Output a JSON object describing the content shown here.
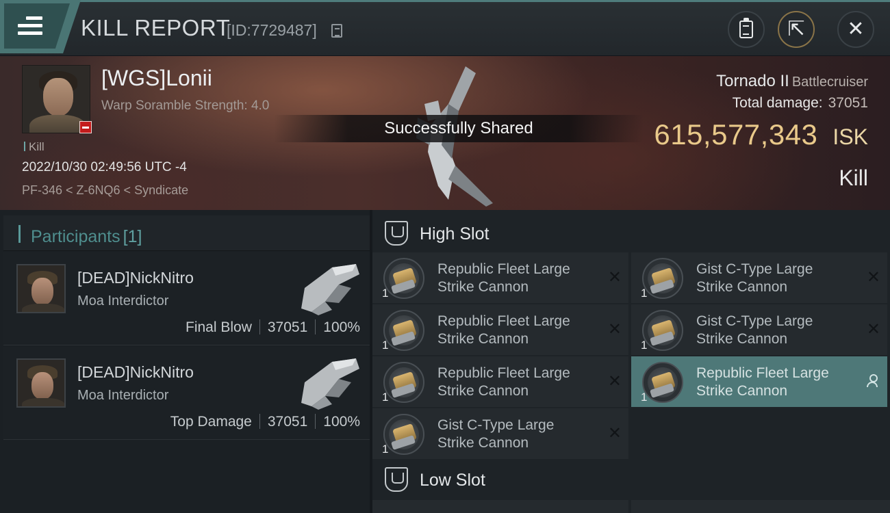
{
  "header": {
    "title": "KILL REPORT",
    "report_id": "[ID:7729487]",
    "icons": {
      "menu": "hamburger-menu-icon",
      "copy": "copy-icon",
      "clipboard": "clipboard-icon",
      "share": "share-icon",
      "close": "close-icon"
    },
    "close_glyph": "✕",
    "share_glyph": "⇱"
  },
  "victim": {
    "name": "[WGS]Lonii",
    "scramble": "Warp Soramble Strength: 4.0",
    "tag": "Kill",
    "timestamp": "2022/10/30 02:49:56 UTC -4",
    "location": "PF-346 < Z-6NQ6 < Syndicate",
    "ship": "Tornado II",
    "ship_class": "Battlecruiser",
    "total_damage_label": "Total damage:",
    "total_damage": "37051",
    "isk_value": "615,577,343",
    "isk_unit": "ISK",
    "result": "Kill"
  },
  "toast": "Successfully Shared",
  "participants": {
    "title": "Participants",
    "count": "[1]",
    "items": [
      {
        "name": "[DEAD]NickNitro",
        "ship": "Moa Interdictor",
        "role": "Final Blow",
        "damage": "37051",
        "percent": "100%"
      },
      {
        "name": "[DEAD]NickNitro",
        "ship": "Moa Interdictor",
        "role": "Top Damage",
        "damage": "37051",
        "percent": "100%"
      }
    ]
  },
  "high_slot": {
    "title": "High Slot",
    "modules": [
      {
        "qty": "1",
        "line1": "Republic Fleet Large",
        "line2": "Strike Cannon",
        "action": "✕"
      },
      {
        "qty": "1",
        "line1": "Gist C-Type Large",
        "line2": "Strike Cannon",
        "action": "✕"
      },
      {
        "qty": "1",
        "line1": "Republic Fleet Large",
        "line2": "Strike Cannon",
        "action": "✕"
      },
      {
        "qty": "1",
        "line1": "Gist C-Type Large",
        "line2": "Strike Cannon",
        "action": "✕"
      },
      {
        "qty": "1",
        "line1": "Republic Fleet Large",
        "line2": "Strike Cannon",
        "action": "✕"
      },
      {
        "qty": "1",
        "line1": "Republic Fleet Large",
        "line2": "Strike Cannon",
        "action": "person-icon",
        "selected": true
      },
      {
        "qty": "1",
        "line1": "Gist C-Type Large",
        "line2": "Strike Cannon",
        "action": "✕"
      }
    ]
  },
  "low_slot": {
    "title": "Low Slot"
  },
  "colors": {
    "accent": "#4f8e8e",
    "isk": "#e9c98a",
    "selected": "#4e7878",
    "status_red": "#c41c1c"
  }
}
